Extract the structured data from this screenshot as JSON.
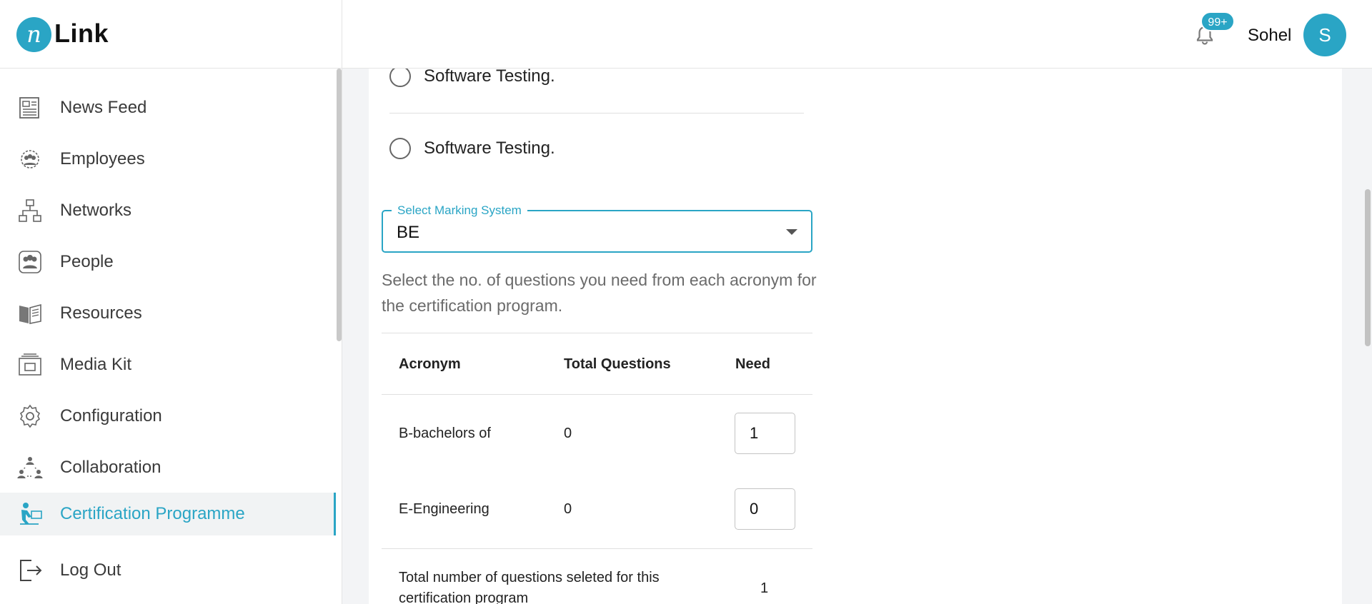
{
  "header": {
    "logo_mark": "n",
    "logo_text": "Link",
    "notification_badge": "99+",
    "user_name": "Sohel",
    "avatar_initial": "S"
  },
  "sidebar": {
    "items": [
      {
        "label": "News Feed",
        "icon": "newspaper-icon"
      },
      {
        "label": "Employees",
        "icon": "employees-icon"
      },
      {
        "label": "Networks",
        "icon": "network-icon"
      },
      {
        "label": "People",
        "icon": "people-icon"
      },
      {
        "label": "Resources",
        "icon": "book-icon"
      },
      {
        "label": "Media Kit",
        "icon": "media-kit-icon"
      },
      {
        "label": "Configuration",
        "icon": "gear-icon"
      },
      {
        "label": "Collaboration",
        "icon": "collaboration-icon"
      },
      {
        "label": "Certification Programme",
        "icon": "certification-icon",
        "active": true
      },
      {
        "label": "Log Out",
        "icon": "logout-icon"
      }
    ]
  },
  "main": {
    "options": [
      "Software Testing.",
      "Software Testing."
    ],
    "marking_select": {
      "label": "Select Marking System",
      "value": "BE"
    },
    "help_text": "Select the no. of questions you need from each acronym for the certification program.",
    "table": {
      "headers": [
        "Acronym",
        "Total Questions",
        "Need"
      ],
      "rows": [
        {
          "acronym": "B-bachelors of",
          "total": "0",
          "need": "1"
        },
        {
          "acronym": "E-Engineering",
          "total": "0",
          "need": "0"
        }
      ],
      "total_label": "Total number of questions seleted for this certification program",
      "total_value": "1"
    }
  },
  "colors": {
    "accent": "#2aa5c5"
  }
}
